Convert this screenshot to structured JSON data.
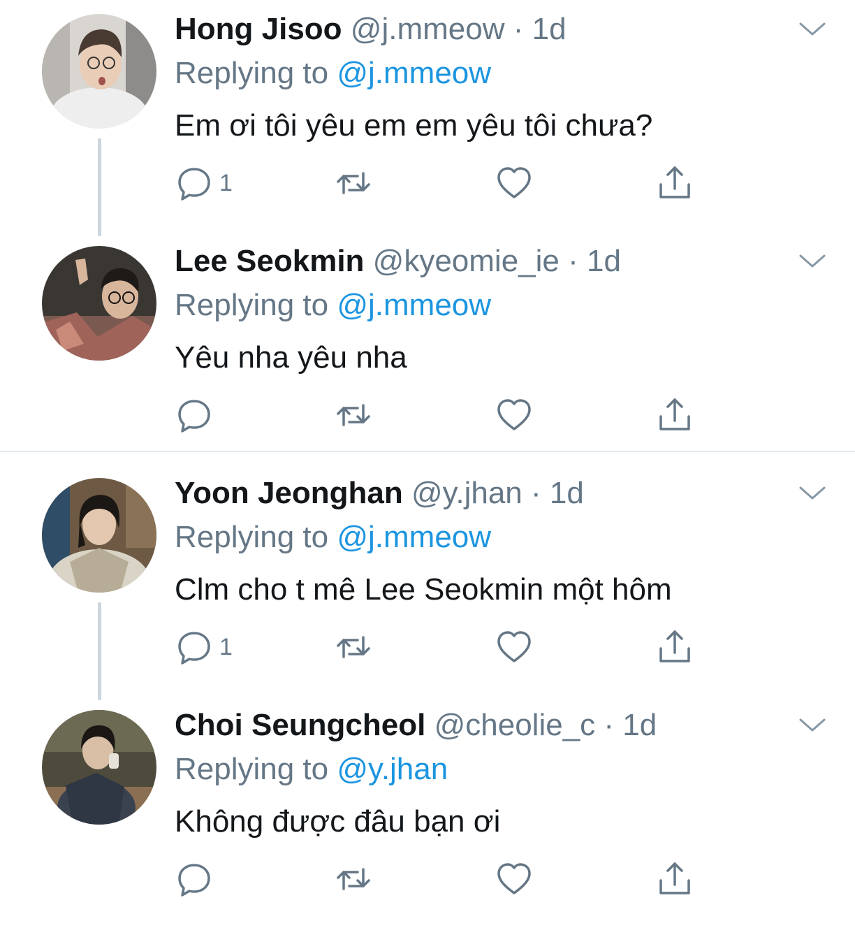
{
  "colors": {
    "text_primary": "#14171a",
    "text_secondary": "#657786",
    "link": "#1b95e0",
    "thread_line": "#ccd6dd",
    "separator": "#e1e8ed"
  },
  "icons": {
    "reply": "speech-bubble-icon",
    "retweet": "retweet-icon",
    "like": "heart-icon",
    "share": "share-icon",
    "more": "chevron-down-icon"
  },
  "tweets": [
    {
      "name": "Hong Jisoo",
      "handle": "@j.mmeow",
      "dot": "·",
      "time": "1d",
      "replying_prefix": "Replying to ",
      "replying_to": "@j.mmeow",
      "text": "Em ơi tôi yêu em em yêu tôi chưa?",
      "reply_count": "1"
    },
    {
      "name": "Lee Seokmin",
      "handle": "@kyeomie_ie",
      "dot": "·",
      "time": "1d",
      "replying_prefix": "Replying to ",
      "replying_to": "@j.mmeow",
      "text": "Yêu nha yêu nha",
      "reply_count": ""
    },
    {
      "name": "Yoon Jeonghan",
      "handle": "@y.jhan",
      "dot": "·",
      "time": "1d",
      "replying_prefix": "Replying to ",
      "replying_to": "@j.mmeow",
      "text": "Clm cho t mê Lee Seokmin một hôm",
      "reply_count": "1"
    },
    {
      "name": "Choi Seungcheol",
      "handle": "@cheolie_c",
      "dot": "·",
      "time": "1d",
      "replying_prefix": "Replying to ",
      "replying_to": "@y.jhan",
      "text": "Không được đâu bạn ơi",
      "reply_count": ""
    }
  ]
}
